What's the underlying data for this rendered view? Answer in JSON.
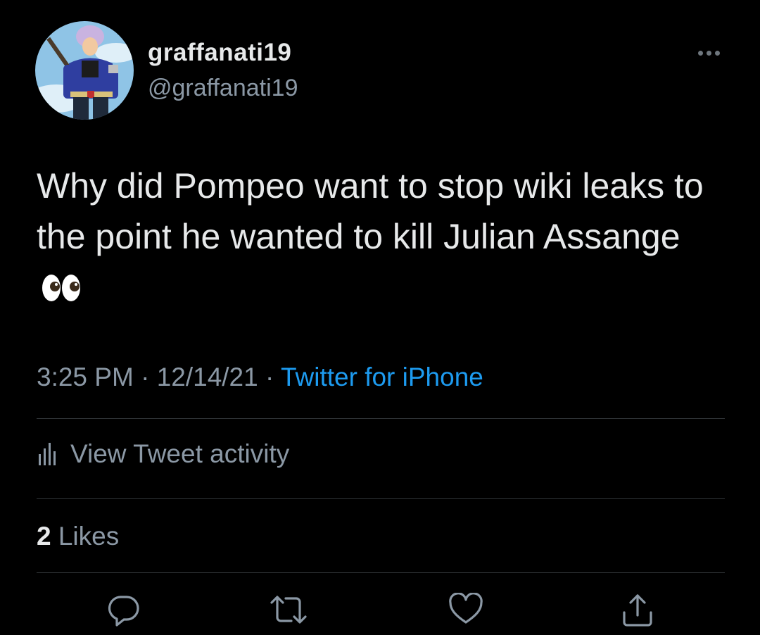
{
  "author": {
    "display_name": "graffanati19",
    "handle": "@graffanati19",
    "avatar_icon": "avatar-icon"
  },
  "more_icon": "more-icon",
  "tweet": {
    "text": "Why did Pompeo want to stop wiki leaks to the point he wanted to kill Julian Assange",
    "emoji_icon": "eyes-emoji-icon",
    "time": "3:25 PM",
    "separator": "·",
    "date": "12/14/21",
    "source": "Twitter for iPhone"
  },
  "activity": {
    "label": "View Tweet activity",
    "icon": "bar-chart-icon"
  },
  "likes": {
    "count": "2",
    "label": "Likes"
  },
  "actions": [
    {
      "icon": "reply-icon"
    },
    {
      "icon": "retweet-icon"
    },
    {
      "icon": "like-icon"
    },
    {
      "icon": "share-icon"
    }
  ],
  "colors": {
    "background": "#000000",
    "primary_text": "#e7e9ea",
    "secondary_text": "#8b98a5",
    "link": "#1d9bf0",
    "divider": "#2f3336"
  }
}
